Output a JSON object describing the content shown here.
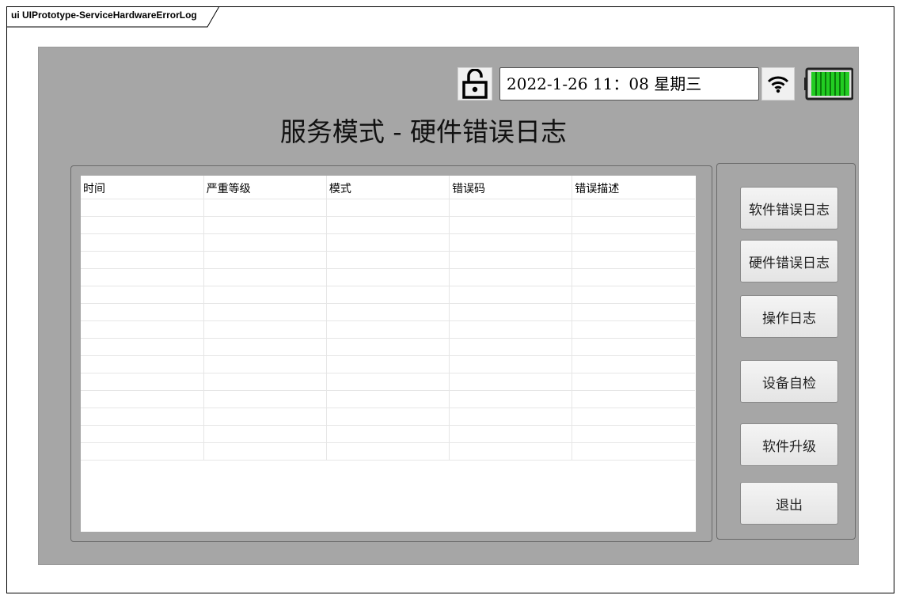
{
  "diagram_tab": {
    "label": "ui UIPrototype-ServiceHardwareErrorLog"
  },
  "status_bar": {
    "datetime": "2022-1-26 11：08 星期三",
    "lock_icon": "unlocked-padlock-icon",
    "wifi_icon": "wifi-icon",
    "battery_icon": "battery-full-icon",
    "battery_color": "#22cc22"
  },
  "page_title": "服务模式 - 硬件错误日志",
  "log_table": {
    "columns": [
      "时间",
      "严重等级",
      "模式",
      "错误码",
      "错误描述"
    ],
    "rows": [
      [
        "",
        "",
        "",
        "",
        ""
      ],
      [
        "",
        "",
        "",
        "",
        ""
      ],
      [
        "",
        "",
        "",
        "",
        ""
      ],
      [
        "",
        "",
        "",
        "",
        ""
      ],
      [
        "",
        "",
        "",
        "",
        ""
      ],
      [
        "",
        "",
        "",
        "",
        ""
      ],
      [
        "",
        "",
        "",
        "",
        ""
      ],
      [
        "",
        "",
        "",
        "",
        ""
      ],
      [
        "",
        "",
        "",
        "",
        ""
      ],
      [
        "",
        "",
        "",
        "",
        ""
      ],
      [
        "",
        "",
        "",
        "",
        ""
      ],
      [
        "",
        "",
        "",
        "",
        ""
      ],
      [
        "",
        "",
        "",
        "",
        ""
      ],
      [
        "",
        "",
        "",
        "",
        ""
      ],
      [
        "",
        "",
        "",
        "",
        ""
      ]
    ]
  },
  "sidebar": {
    "buttons": [
      {
        "label": "软件错误日志"
      },
      {
        "label": "硬件错误日志"
      },
      {
        "label": "操作日志"
      },
      {
        "label": "设备自检"
      },
      {
        "label": "软件升级"
      },
      {
        "label": "退出"
      }
    ]
  },
  "colors": {
    "screen_background": "#a6a6a6",
    "button_background": "#f0f0f0"
  }
}
